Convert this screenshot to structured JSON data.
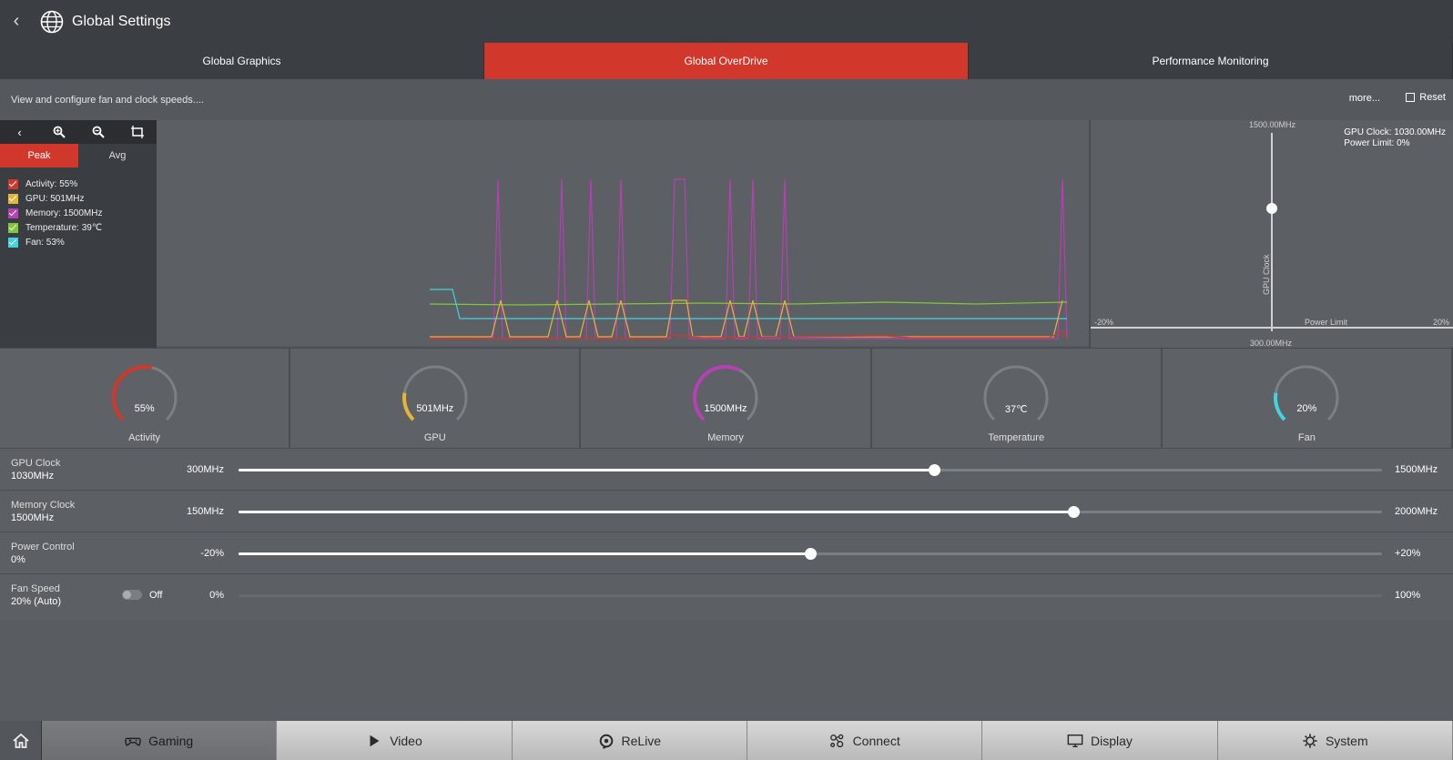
{
  "header": {
    "title": "Global Settings"
  },
  "tabs": [
    {
      "label": "Global Graphics"
    },
    {
      "label": "Global OverDrive"
    },
    {
      "label": "Performance Monitoring"
    }
  ],
  "infobar": {
    "description": "View and configure fan and clock speeds....",
    "more": "more...",
    "reset": "Reset"
  },
  "graph": {
    "toggle": {
      "peak": "Peak",
      "avg": "Avg"
    },
    "legend": [
      {
        "label": "Activity: 55%",
        "color": "#d2372b"
      },
      {
        "label": "GPU: 501MHz",
        "color": "#e5b53a"
      },
      {
        "label": "Memory: 1500MHz",
        "color": "#b83fb6"
      },
      {
        "label": "Temperature: 39℃",
        "color": "#7ec83a"
      },
      {
        "label": "Fan: 53%",
        "color": "#3fd4e0"
      }
    ]
  },
  "side_chart": {
    "gpu_clock_line": "GPU Clock: 1030.00MHz",
    "power_limit_line": "Power Limit: 0%",
    "y_max": "1500.00MHz",
    "y_min": "300.00MHz",
    "x_min": "-20%",
    "x_max": "20%",
    "x_label": "Power Limit",
    "y_label": "GPU Clock"
  },
  "gauges": [
    {
      "label": "Activity",
      "value": "55%",
      "fraction": 0.55,
      "color": "#d2372b"
    },
    {
      "label": "GPU",
      "value": "501MHz",
      "fraction": 0.2,
      "color": "#e5b53a"
    },
    {
      "label": "Memory",
      "value": "1500MHz",
      "fraction": 0.6,
      "color": "#b83fb6"
    },
    {
      "label": "Temperature",
      "value": "37℃",
      "fraction": 0,
      "color": "#bfbfbf"
    },
    {
      "label": "Fan",
      "value": "20%",
      "fraction": 0.2,
      "color": "#3fd4e0"
    }
  ],
  "controls": [
    {
      "name": "GPU Clock",
      "value": "1030MHz",
      "min": "300MHz",
      "max": "1500MHz",
      "fraction": 0.608
    },
    {
      "name": "Memory Clock",
      "value": "1500MHz",
      "min": "150MHz",
      "max": "2000MHz",
      "fraction": 0.73
    },
    {
      "name": "Power Control",
      "value": "0%",
      "min": "-20%",
      "max": "+20%",
      "fraction": 0.5
    },
    {
      "name": "Fan Speed",
      "value": "20% (Auto)",
      "min": "0%",
      "max": "100%",
      "toggle": "Off"
    }
  ],
  "bottom_nav": [
    {
      "label": "Gaming",
      "icon": "gamepad-icon"
    },
    {
      "label": "Video",
      "icon": "play-icon"
    },
    {
      "label": "ReLive",
      "icon": "relive-icon"
    },
    {
      "label": "Connect",
      "icon": "connect-icon"
    },
    {
      "label": "Display",
      "icon": "monitor-icon"
    },
    {
      "label": "System",
      "icon": "gear-icon"
    }
  ]
}
